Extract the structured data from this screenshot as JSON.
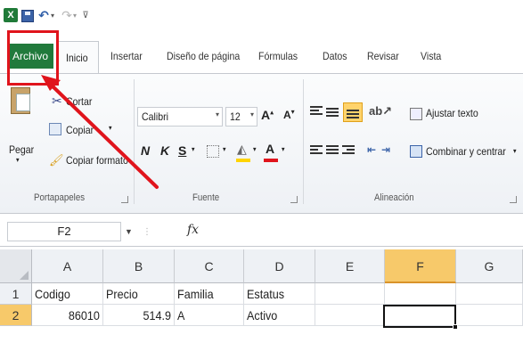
{
  "app": {
    "logo_letter": "X",
    "accent_color": "#217a3c",
    "highlight_color": "#e0141c"
  },
  "qat": {
    "icons": [
      "excel-logo-icon",
      "save-icon",
      "undo-icon",
      "redo-icon",
      "customize-qat-icon"
    ]
  },
  "tabs": {
    "file": "Archivo",
    "home": "Inicio",
    "insert": "Insertar",
    "page_layout": "Diseño de página",
    "formulas": "Fórmulas",
    "data": "Datos",
    "review": "Revisar",
    "view": "Vista"
  },
  "ribbon": {
    "clipboard": {
      "cut": "Cortar",
      "copy": "Copiar",
      "paste": "Pegar",
      "format_painter": "Copiar formato",
      "group_label": "Portapapeles"
    },
    "font": {
      "font_name": "Calibri",
      "font_size": "12",
      "bold": "N",
      "italic": "K",
      "underline": "S",
      "group_label": "Fuente",
      "fill_color": "#ffd400",
      "font_color": "#e0141c"
    },
    "alignment": {
      "wrap_text": "Ajustar texto",
      "merge_center": "Combinar y centrar",
      "group_label": "Alineación"
    }
  },
  "formula_bar": {
    "name_box": "F2",
    "fx_label": "fx",
    "formula": ""
  },
  "grid": {
    "columns": [
      "A",
      "B",
      "C",
      "D",
      "E",
      "F",
      "G"
    ],
    "selected_column": "F",
    "rows": [
      "1",
      "2"
    ],
    "selected_row": "2",
    "cells": {
      "A1": "Codigo",
      "B1": "Precio",
      "C1": "Familia",
      "D1": "Estatus",
      "A2": "86010",
      "B2": "514.9",
      "C2": "A",
      "D2": "Activo"
    }
  }
}
